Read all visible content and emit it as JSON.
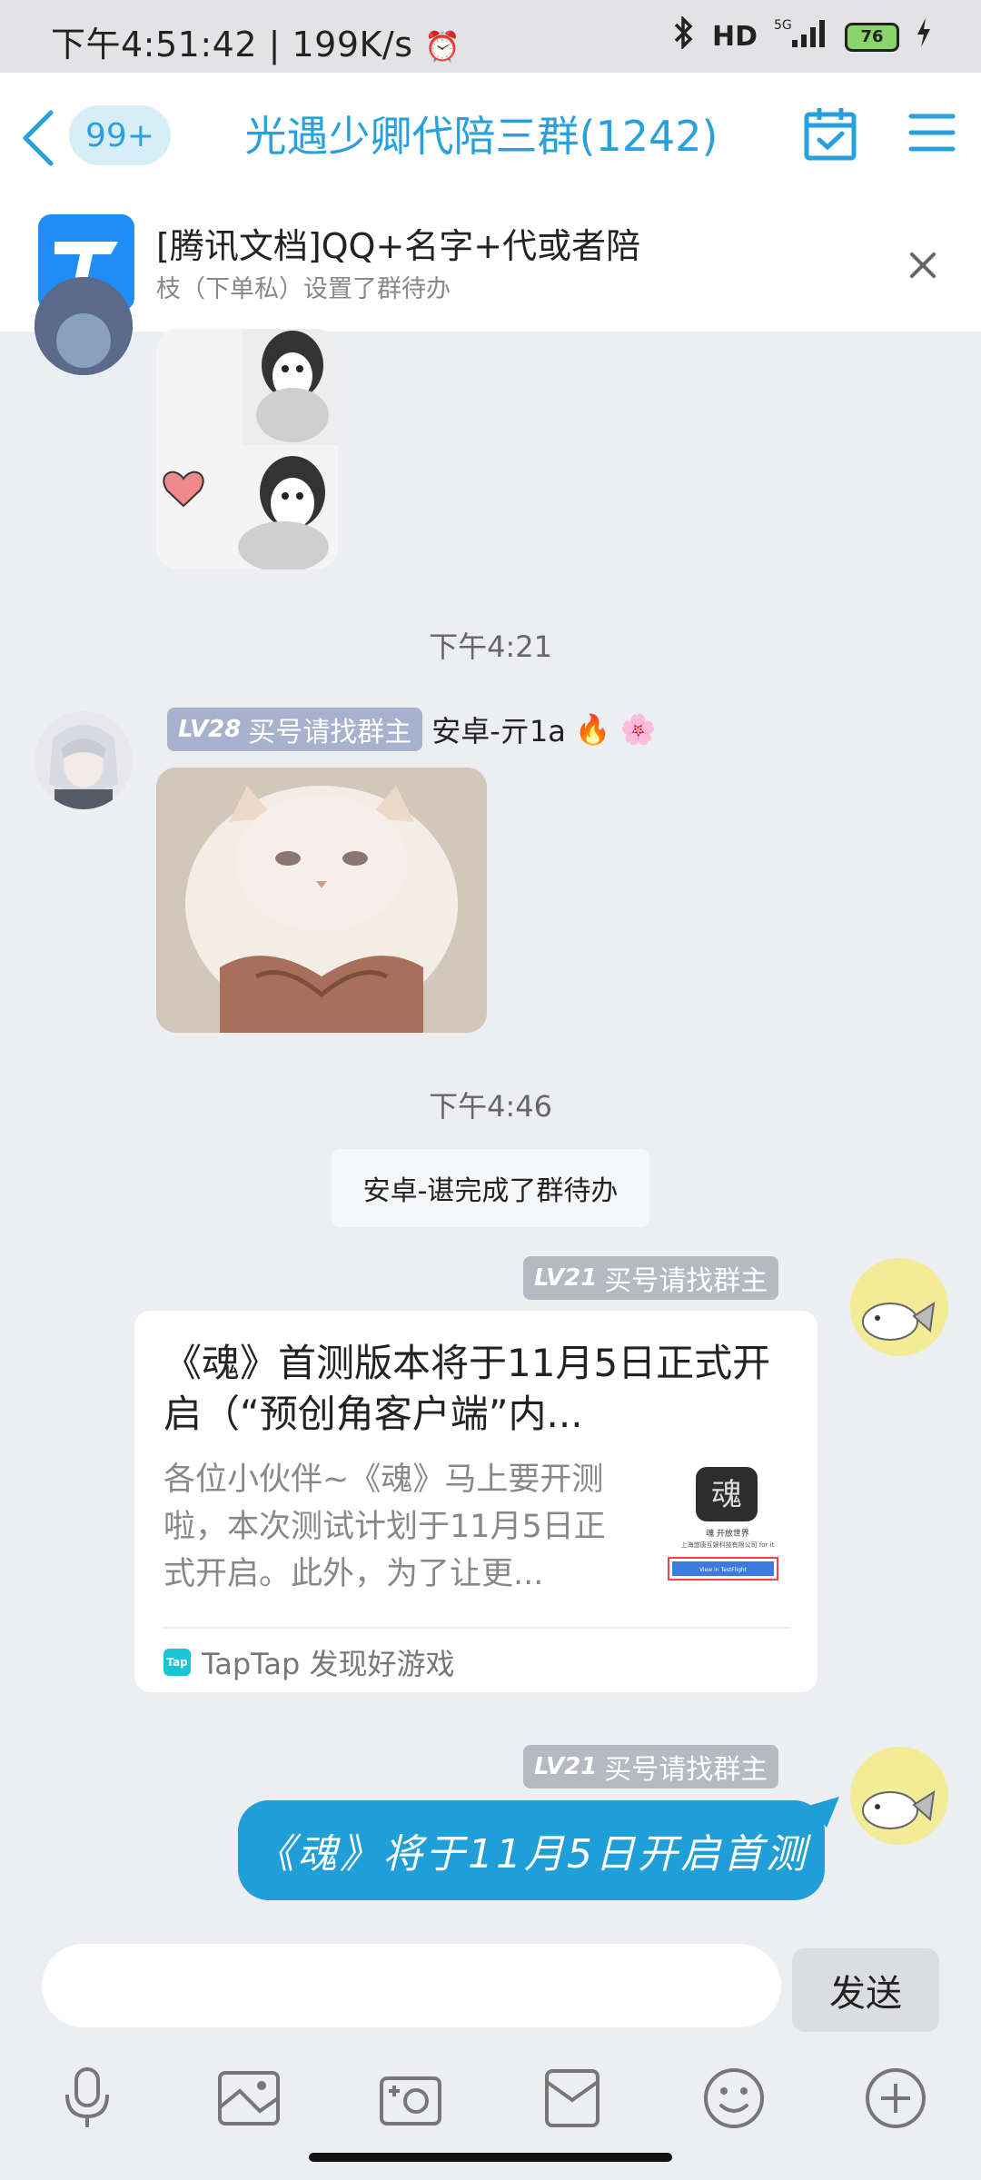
{
  "status_bar": {
    "time": "下午4:51:42",
    "speed": "199K/s",
    "battery": "76"
  },
  "header": {
    "unread_badge": "99+",
    "title": "光遇少卿代陪三群(1242)"
  },
  "pinned": {
    "title": "[腾讯文档]QQ+名字+代或者陪",
    "subtitle": "枝（下单私）设置了群待办"
  },
  "messages": {
    "time1": "下午4:21",
    "sender2": {
      "level": "LV28",
      "title_tag": "买号请找群主",
      "name": "安卓-亓1a"
    },
    "time2": "下午4:46",
    "system_notice": "安卓-谌完成了群待办",
    "self_card_meta": {
      "level": "LV21",
      "title_tag": "买号请找群主"
    },
    "card": {
      "title": "《魂》首测版本将于11月5日正式开启（“预创角客户端”内...",
      "description": "各位小伙伴~《魂》马上要开测啦，本次测试计划于11月5日正式开启。此外，为了让更...",
      "thumb_caption": "魂 开放世界",
      "thumb_company": "上海悠唐互娱科技有限公司 for it",
      "thumb_button": "View in TestFlight",
      "source": "TapTap 发现好游戏",
      "source_logo": "Tap"
    },
    "self_bubble_meta": {
      "level": "LV21",
      "title_tag": "买号请找群主"
    },
    "self_bubble_text": "《魂》将于11月5日开启首测"
  },
  "input": {
    "placeholder": "",
    "send_label": "发送"
  },
  "toolbar": [
    "microphone-icon",
    "image-icon",
    "camera-icon",
    "folder-icon",
    "emoji-icon",
    "plus-icon"
  ],
  "colors": {
    "accent": "#27a1dc",
    "bubble": "#1f9ed8",
    "background": "#eceef2"
  }
}
